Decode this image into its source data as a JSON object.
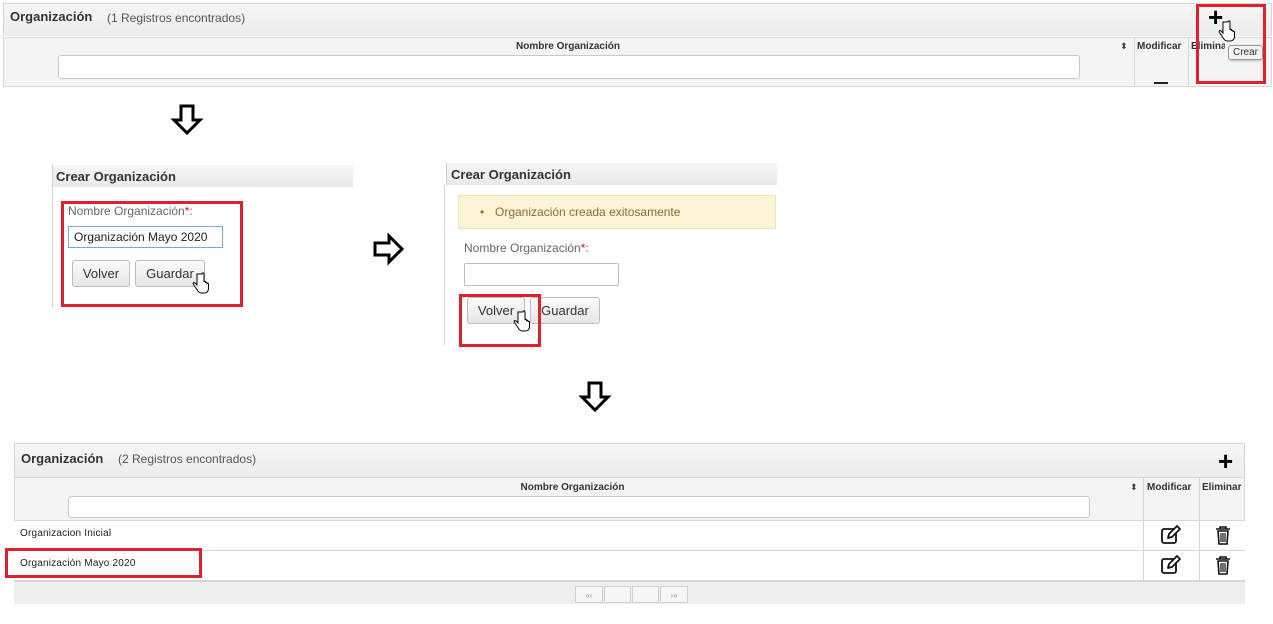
{
  "panel_top": {
    "title": "Organización",
    "count": "(1 Registros encontrados)",
    "add_icon": "plus-icon",
    "columns": {
      "name": "Nombre Organización",
      "modify": "Modificar",
      "delete": "Eliminar"
    },
    "tooltip": "Crear",
    "sort_glyph": "⬍"
  },
  "form_create": {
    "title": "Crear Organización",
    "label": "Nombre Organización",
    "required_mark": "*",
    "colon": ":",
    "value": "Organización Mayo 2020",
    "back_label": "Volver",
    "save_label": "Guardar"
  },
  "form_created": {
    "title": "Crear Organización",
    "message": "Organización creada exitosamente",
    "bullet": "•",
    "label": "Nombre Organización",
    "required_mark": "*",
    "colon": ":",
    "value": "",
    "back_label": "Volver",
    "save_label": "Guardar"
  },
  "panel_bottom": {
    "title": "Organización",
    "count": "(2 Registros encontrados)",
    "add_icon": "plus-icon",
    "columns": {
      "name": "Nombre Organización",
      "modify": "Modificar",
      "delete": "Eliminar"
    },
    "sort_glyph": "⬍",
    "rows": [
      {
        "name": "Organizacion Inicial"
      },
      {
        "name": "Organización Mayo 2020"
      }
    ],
    "pagination": {
      "first": "«‹",
      "last": "›»"
    }
  },
  "colors": {
    "highlight": "#e0202c",
    "alert_bg": "#fcf4d4",
    "alert_text": "#8a6d3b",
    "required": "#dd1111"
  }
}
